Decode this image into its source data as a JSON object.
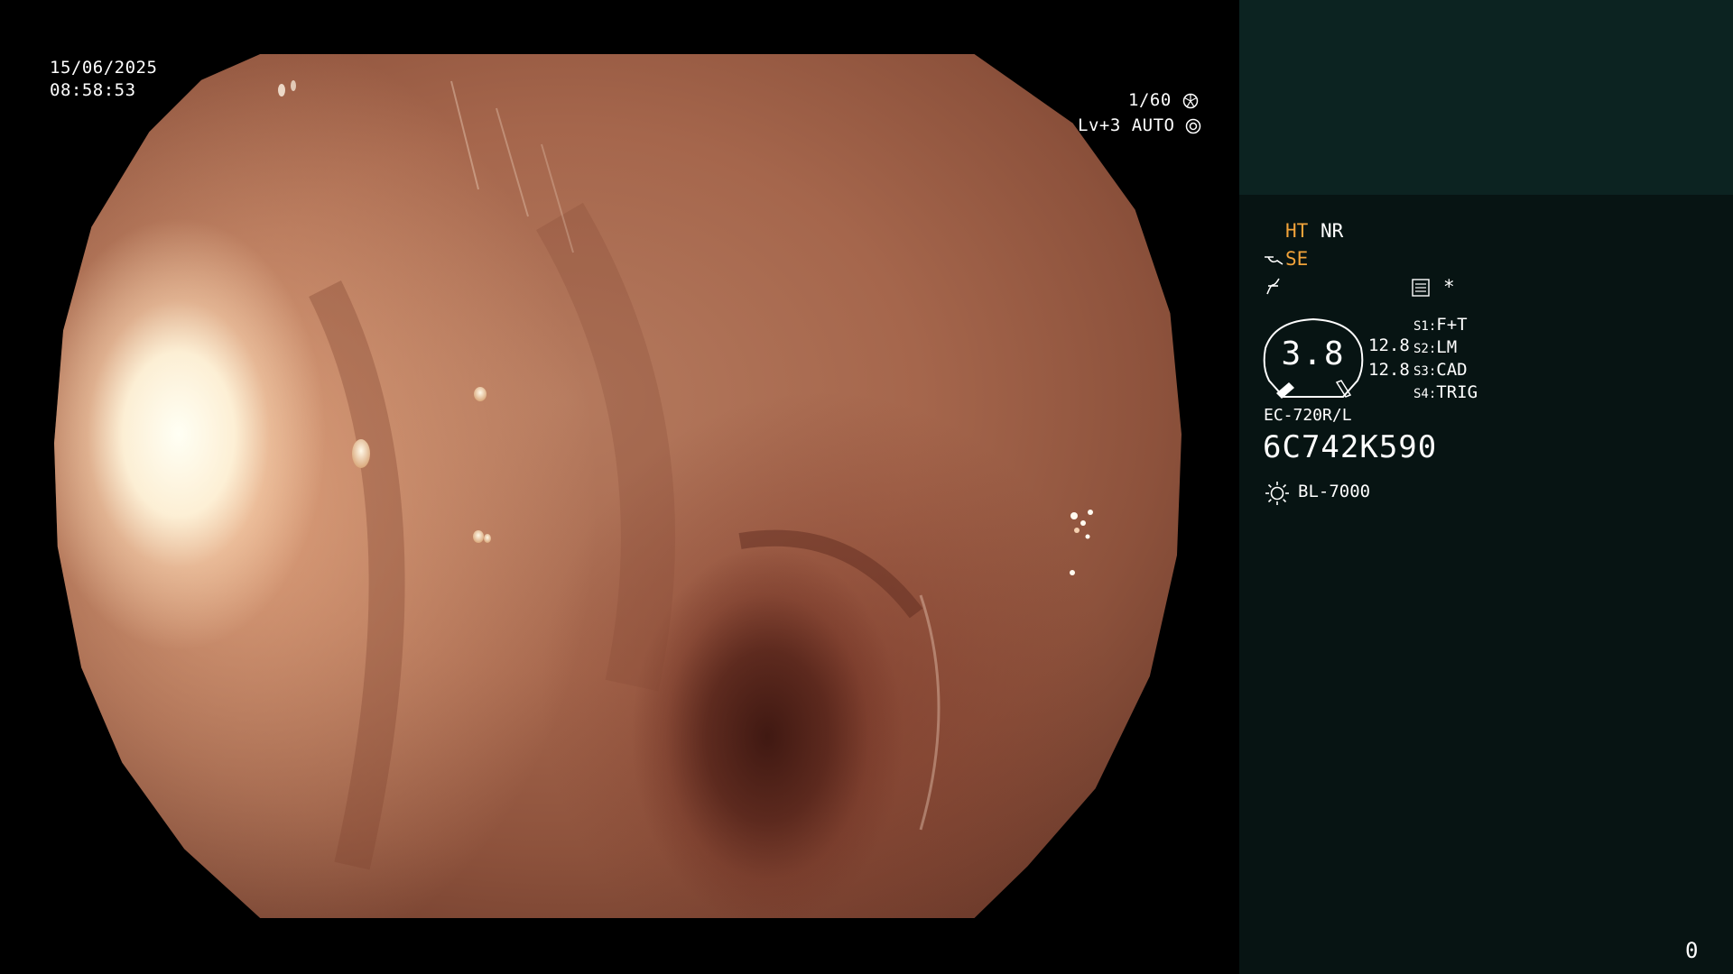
{
  "overlay": {
    "date": "15/06/2025",
    "time": "08:58:53",
    "shutter": "1/60",
    "iris": "Lv+3 AUTO"
  },
  "panel": {
    "enhancement": "HT",
    "noise_reduction": "NR",
    "structure_enhance": "SE",
    "zoom_value": "3.8",
    "zoom_scale_upper": "12.8",
    "zoom_scale_lower": "12.8",
    "switches": [
      {
        "key": "S1",
        "value": "F+T"
      },
      {
        "key": "S2",
        "value": "LM"
      },
      {
        "key": "S3",
        "value": "CAD"
      },
      {
        "key": "S4",
        "value": "TRIG"
      }
    ],
    "scope_model": "EC-720R/L",
    "serial_number": "6C742K590",
    "light_source": "BL-7000",
    "asterisk": "*",
    "counter": "0"
  },
  "colors": {
    "accent_orange": "#f2a33a",
    "panel_bg": "#071413",
    "thumbnail_bg": "#0c2321",
    "mucosa": "#a5664c"
  },
  "icons": [
    "shutter-icon",
    "iris-icon",
    "scope-angle-icon",
    "freeze-icon",
    "menu-icon",
    "light-source-icon"
  ]
}
